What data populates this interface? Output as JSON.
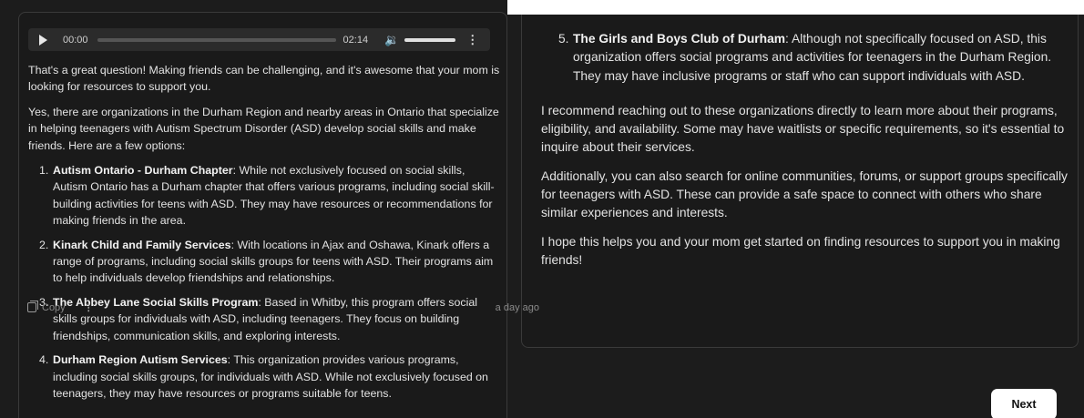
{
  "audio": {
    "current_time": "00:00",
    "duration": "02:14",
    "progress": 0
  },
  "left": {
    "intro1": "That's a great question! Making friends can be challenging, and it's awesome that your mom is looking for resources to support you.",
    "intro2": "Yes, there are organizations in the Durham Region and nearby areas in Ontario that specialize in helping teenagers with Autism Spectrum Disorder (ASD) develop social skills and make friends. Here are a few options:",
    "items": [
      {
        "num": "1.",
        "title": "Autism Ontario - Durham Chapter",
        "text": ": While not exclusively focused on social skills, Autism Ontario has a Durham chapter that offers various programs, including social skill-building activities for teens with ASD. They may have resources or recommendations for making friends in the area."
      },
      {
        "num": "2.",
        "title": "Kinark Child and Family Services",
        "text": ": With locations in Ajax and Oshawa, Kinark offers a range of programs, including social skills groups for teens with ASD. Their programs aim to help individuals develop friendships and relationships."
      },
      {
        "num": "3.",
        "title": "The Abbey Lane Social Skills Program",
        "text": ": Based in Whitby, this program offers social skills groups for individuals with ASD, including teenagers. They focus on building friendships, communication skills, and exploring interests."
      },
      {
        "num": "4.",
        "title": "Durham Region Autism Services",
        "text": ": This organization provides various programs, including social skills groups, for individuals with ASD. While not exclusively focused on teenagers, they may have resources or programs suitable for teens."
      }
    ]
  },
  "right": {
    "item5": {
      "num": "5.",
      "title": "The Girls and Boys Club of Durham",
      "text": ": Although not specifically focused on ASD, this organization offers social programs and activities for teenagers in the Durham Region. They may have inclusive programs or staff who can support individuals with ASD."
    },
    "para1": "I recommend reaching out to these organizations directly to learn more about their programs, eligibility, and availability. Some may have waitlists or specific requirements, so it's essential to inquire about their services.",
    "para2": "Additionally, you can also search for online communities, forums, or support groups specifically for teenagers with ASD. These can provide a safe space to connect with others who share similar experiences and interests.",
    "para3": "I hope this helps you and your mom get started on finding resources to support you in making friends!",
    "copy_label": "Copy",
    "timestamp": "a day ago"
  },
  "next_label": "Next"
}
